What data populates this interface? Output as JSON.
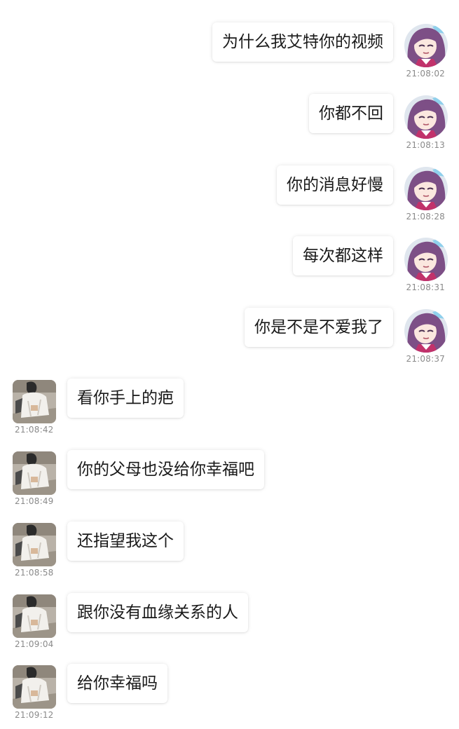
{
  "conversation": {
    "messages": [
      {
        "side": "right",
        "text": "为什么我艾特你的视频",
        "time": "21:08:02",
        "avatar": "anime-girl-avatar"
      },
      {
        "side": "right",
        "text": "你都不回",
        "time": "21:08:13",
        "avatar": "anime-girl-avatar"
      },
      {
        "side": "right",
        "text": "你的消息好慢",
        "time": "21:08:28",
        "avatar": "anime-girl-avatar"
      },
      {
        "side": "right",
        "text": "每次都这样",
        "time": "21:08:31",
        "avatar": "anime-girl-avatar"
      },
      {
        "side": "right",
        "text": "你是不是不爱我了",
        "time": "21:08:37",
        "avatar": "anime-girl-avatar"
      },
      {
        "side": "left",
        "text": "看你手上的疤",
        "time": "21:08:42",
        "avatar": "photo-avatar"
      },
      {
        "side": "left",
        "text": "你的父母也没给你幸福吧",
        "time": "21:08:49",
        "avatar": "photo-avatar"
      },
      {
        "side": "left",
        "text": "还指望我这个",
        "time": "21:08:58",
        "avatar": "photo-avatar"
      },
      {
        "side": "left",
        "text": "跟你没有血缘关系的人",
        "time": "21:09:04",
        "avatar": "photo-avatar"
      },
      {
        "side": "left",
        "text": "给你幸福吗",
        "time": "21:09:12",
        "avatar": "photo-avatar"
      }
    ]
  }
}
